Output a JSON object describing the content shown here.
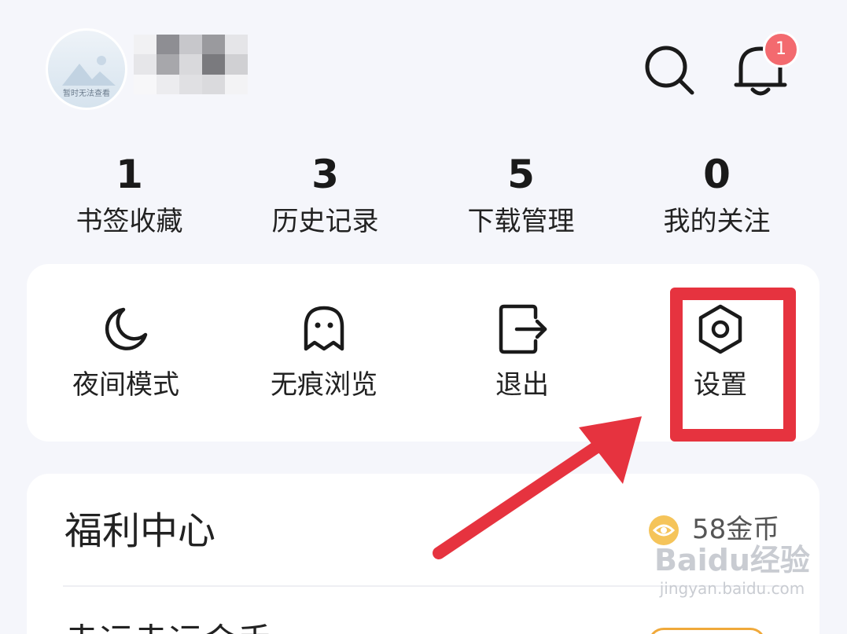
{
  "profile": {
    "avatar_caption": "暂时无法查看",
    "username_blurred": true
  },
  "header": {
    "search_icon": "search-icon",
    "bell_icon": "bell-icon",
    "notification_count": "1"
  },
  "stats": [
    {
      "count": "1",
      "label": "书签收藏"
    },
    {
      "count": "3",
      "label": "历史记录"
    },
    {
      "count": "5",
      "label": "下载管理"
    },
    {
      "count": "0",
      "label": "我的关注"
    }
  ],
  "actions": [
    {
      "label": "夜间模式",
      "icon": "moon-icon"
    },
    {
      "label": "无痕浏览",
      "icon": "ghost-icon"
    },
    {
      "label": "退出",
      "icon": "logout-icon"
    },
    {
      "label": "设置",
      "icon": "settings-hexagon-icon"
    }
  ],
  "welfare": {
    "title": "福利中心",
    "coins": "58金币",
    "next_title": "幸运幸运金手"
  },
  "annotation": {
    "highlight_color": "#e6333f"
  },
  "watermark": {
    "main": "Baidu经验",
    "sub": "jingyan.baidu.com"
  },
  "colors": {
    "background": "#f5f6fb",
    "badge": "#f36a6f",
    "coin": "#f5c45a"
  }
}
